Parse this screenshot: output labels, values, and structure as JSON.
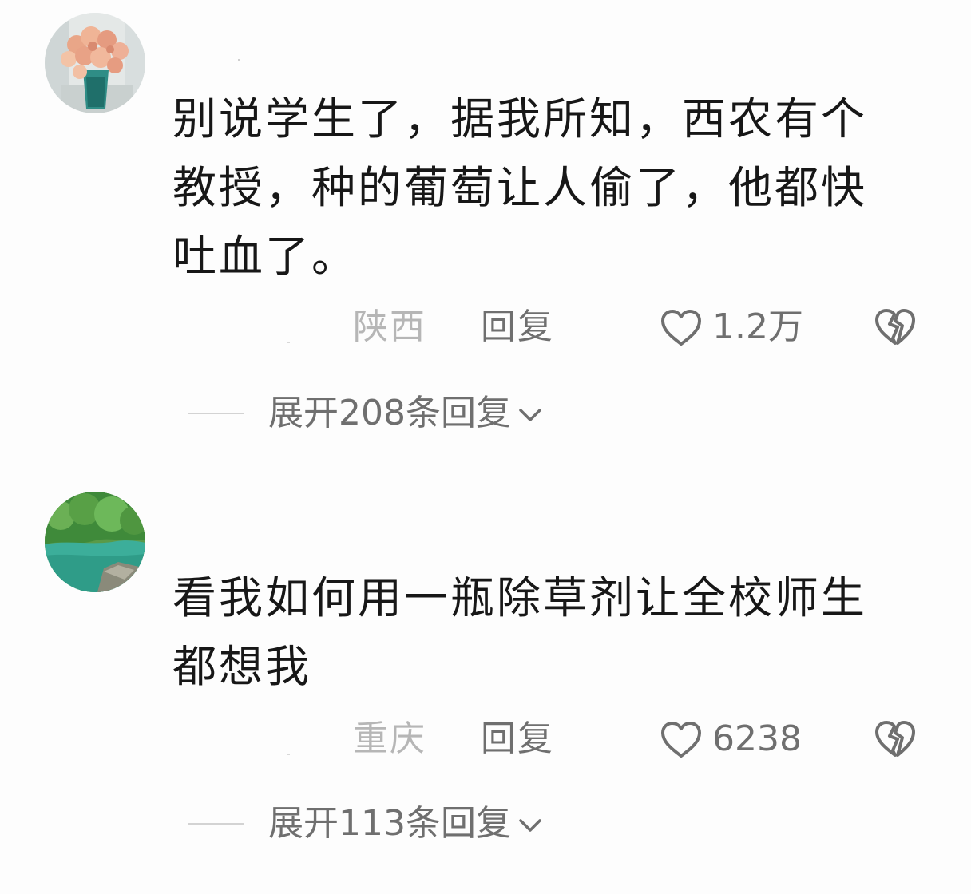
{
  "comments": [
    {
      "avatar_icon": "flower-vase-avatar",
      "text": "别说学生了，据我所知，西农有个教授，种的葡萄让人偷了，他都快吐血了。",
      "location": "陕西",
      "reply_label": "回复",
      "like_count": "1.2万",
      "expand_label": "展开208条回复"
    },
    {
      "avatar_icon": "lake-scenery-avatar",
      "text": "看我如何用一瓶除草剂让全校师生都想我",
      "location": "重庆",
      "reply_label": "回复",
      "like_count": "6238",
      "expand_label": "展开113条回复"
    }
  ],
  "icons": {
    "like": "heart-outline-icon",
    "dislike": "broken-heart-icon",
    "expand": "chevron-down-icon"
  },
  "colors": {
    "text": "#171717",
    "secondary": "#6f6f6f",
    "location": "#b6b6b6",
    "background": "#fdfdfd"
  }
}
